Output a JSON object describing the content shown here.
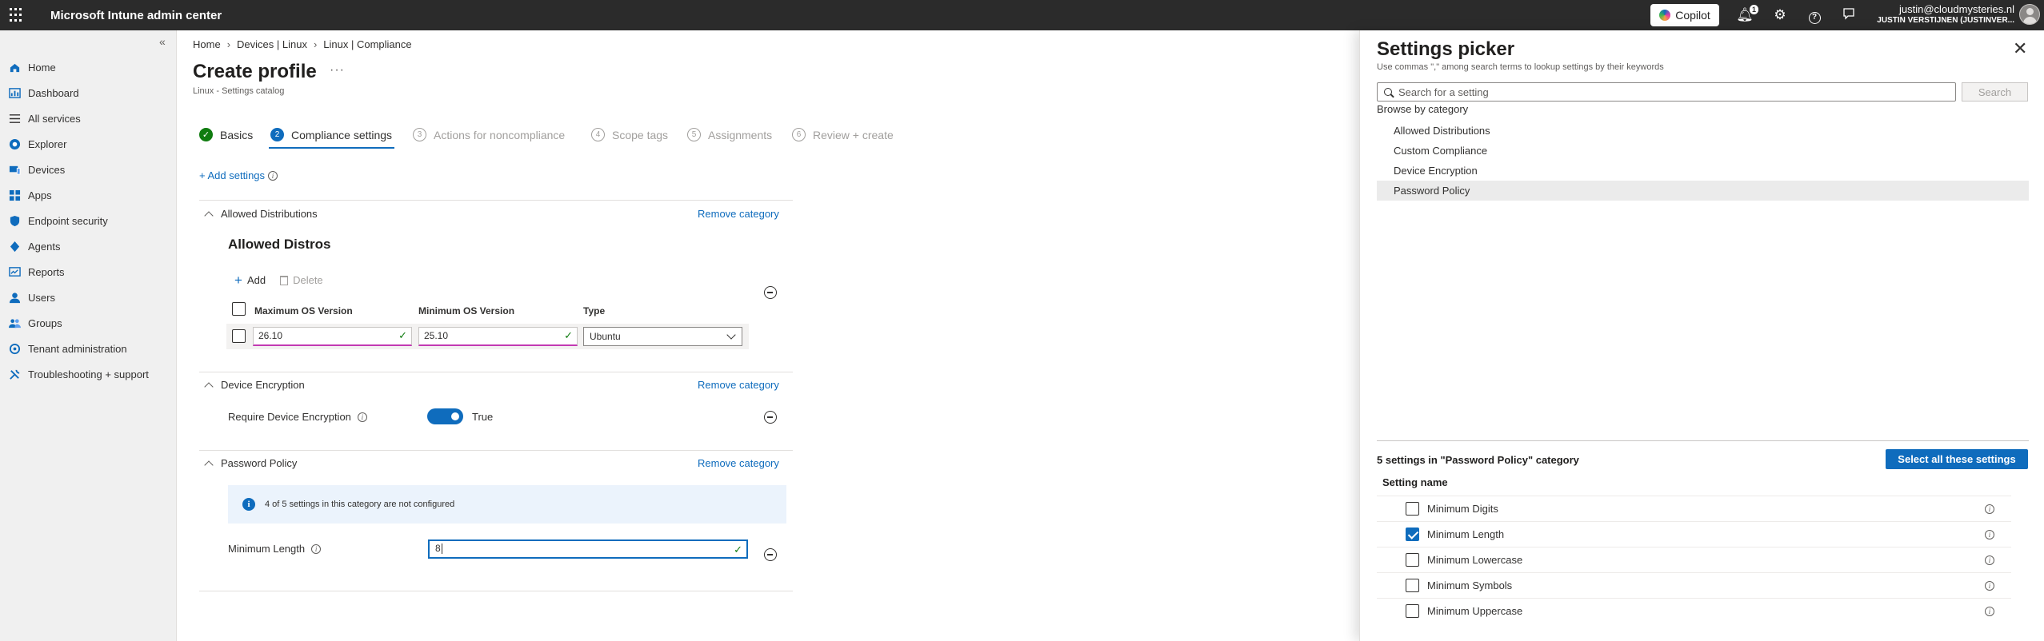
{
  "app": {
    "title": "Microsoft Intune admin center",
    "copilot_label": "Copilot",
    "notification_count": "1",
    "user_email": "justin@cloudmysteries.nl",
    "user_tenant": "JUSTIN VERSTIJNEN (JUSTINVER..."
  },
  "sidebar": {
    "items": [
      {
        "label": "Home",
        "icon": "home-icon"
      },
      {
        "label": "Dashboard",
        "icon": "dashboard-icon"
      },
      {
        "label": "All services",
        "icon": "list-icon"
      },
      {
        "label": "Explorer",
        "icon": "explorer-icon"
      },
      {
        "label": "Devices",
        "icon": "devices-icon"
      },
      {
        "label": "Apps",
        "icon": "apps-icon"
      },
      {
        "label": "Endpoint security",
        "icon": "shield-icon"
      },
      {
        "label": "Agents",
        "icon": "agents-icon"
      },
      {
        "label": "Reports",
        "icon": "reports-icon"
      },
      {
        "label": "Users",
        "icon": "user-icon"
      },
      {
        "label": "Groups",
        "icon": "groups-icon"
      },
      {
        "label": "Tenant administration",
        "icon": "tenant-icon"
      },
      {
        "label": "Troubleshooting + support",
        "icon": "wrench-icon"
      }
    ]
  },
  "breadcrumb": [
    "Home",
    "Devices | Linux",
    "Linux | Compliance"
  ],
  "page": {
    "title": "Create profile",
    "more": "···",
    "subtitle": "Linux - Settings catalog"
  },
  "wizard": {
    "steps": [
      {
        "num": "✓",
        "label": "Basics",
        "state": "done"
      },
      {
        "num": "2",
        "label": "Compliance settings",
        "state": "active"
      },
      {
        "num": "3",
        "label": "Actions for noncompliance",
        "state": "disabled"
      },
      {
        "num": "4",
        "label": "Scope tags",
        "state": "disabled"
      },
      {
        "num": "5",
        "label": "Assignments",
        "state": "disabled"
      },
      {
        "num": "6",
        "label": "Review + create",
        "state": "disabled"
      }
    ]
  },
  "add_settings": "+ Add settings",
  "remove_category": "Remove category",
  "categories": {
    "allowed": {
      "name": "Allowed Distributions",
      "subtitle": "Allowed Distros",
      "add": "Add",
      "delete": "Delete",
      "columns": [
        "Maximum OS Version",
        "Minimum OS Version",
        "Type"
      ],
      "row": {
        "max": "26.10",
        "min": "25.10",
        "type": "Ubuntu"
      }
    },
    "encryption": {
      "name": "Device Encryption",
      "setting": "Require Device Encryption",
      "value": "True"
    },
    "password": {
      "name": "Password Policy",
      "info": "4 of 5 settings in this category are not configured",
      "setting": "Minimum Length",
      "value": "8"
    }
  },
  "picker": {
    "title": "Settings picker",
    "subtitle": "Use commas \",\" among search terms to lookup settings by their keywords",
    "search_placeholder": "Search for a setting",
    "search_button": "Search",
    "browse_label": "Browse by category",
    "categories": [
      "Allowed Distributions",
      "Custom Compliance",
      "Device Encryption",
      "Password Policy"
    ],
    "selected_category": "Password Policy",
    "count_label": "5 settings in \"Password Policy\" category",
    "select_all": "Select all these settings",
    "column": "Setting name",
    "settings": [
      {
        "name": "Minimum Digits",
        "checked": false
      },
      {
        "name": "Minimum Length",
        "checked": true
      },
      {
        "name": "Minimum Lowercase",
        "checked": false
      },
      {
        "name": "Minimum Symbols",
        "checked": false
      },
      {
        "name": "Minimum Uppercase",
        "checked": false
      }
    ]
  }
}
